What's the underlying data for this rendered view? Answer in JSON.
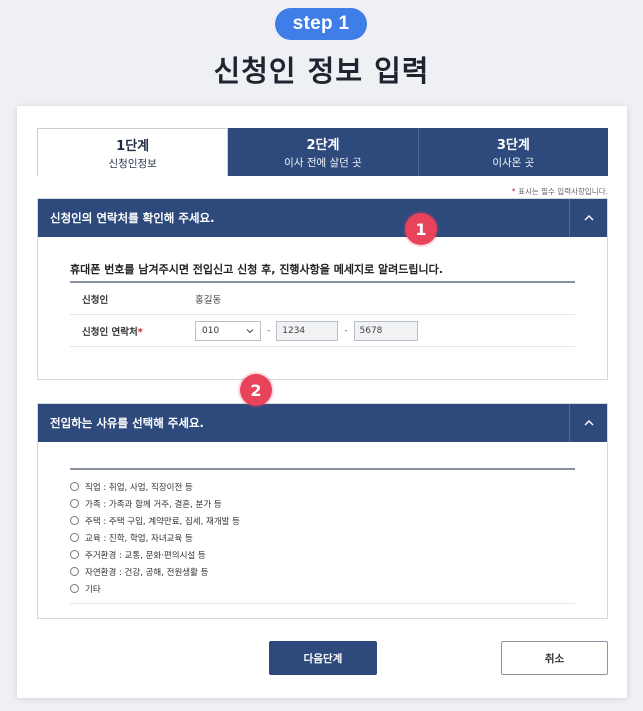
{
  "header": {
    "step_pill": "step 1",
    "title": "신청인 정보 입력"
  },
  "steps": [
    {
      "num": "1단계",
      "label": "신청인정보",
      "active": true
    },
    {
      "num": "2단계",
      "label": "이사 전에 살던 곳",
      "active": false
    },
    {
      "num": "3단계",
      "label": "이사온 곳",
      "active": false
    }
  ],
  "required_note": {
    "star": "*",
    "text": " 표시는 필수 입력사항입니다."
  },
  "contact_section": {
    "title": "신청인의 연락처를 확인해 주세요.",
    "collapse_icon": "chevron-up-icon",
    "notice": "휴대폰 번호를 남겨주시면 전입신고 신청 후, 진행사항을 메세지로 알려드립니다.",
    "applicant_label": "신청인",
    "applicant_value": "홍길동",
    "phone_label": "신청인 연락처",
    "phone_required": "*",
    "phone_prefix": "010",
    "dash": "-",
    "phone_middle": "1234",
    "phone_last": "5678"
  },
  "badges": {
    "one": "1",
    "two": "2"
  },
  "reason_section": {
    "title": "전입하는 사유를 선택해 주세요.",
    "collapse_icon": "chevron-up-icon",
    "options": [
      "직업 : 취업, 사업, 직장이전 등",
      "가족 : 가족과 함께 거주, 결혼, 분가 등",
      "주택 : 주택 구입, 계약만료, 집세, 재개발 등",
      "교육 : 진학, 학업, 자녀교육 등",
      "주거환경 : 교통, 문화·편의시설 등",
      "자연환경 : 건강, 공해, 전원생활 등",
      "기타"
    ]
  },
  "buttons": {
    "next": "다음단계",
    "cancel": "취소"
  },
  "colors": {
    "navy": "#2e4a7d",
    "pill_blue": "#3f7ee6",
    "badge_red": "#e8435a"
  }
}
